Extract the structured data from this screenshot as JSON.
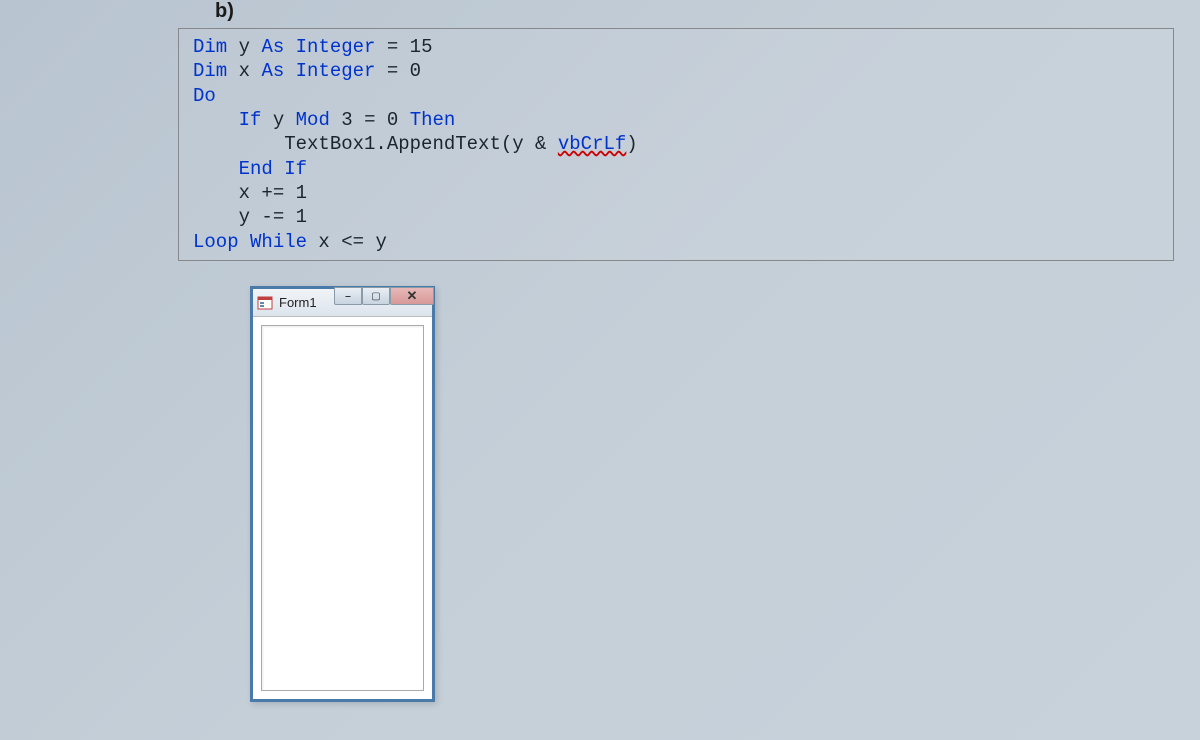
{
  "question_label": "b)",
  "code": {
    "l1_kw1": "Dim",
    "l1_txt": " y ",
    "l1_kw2": "As Integer",
    "l1_rest": " = 15",
    "l2_kw1": "Dim",
    "l2_txt": " x ",
    "l2_kw2": "As Integer",
    "l2_rest": " = 0",
    "l3_kw": "Do",
    "l4_kw1": "If",
    "l4_txt1": " y ",
    "l4_kw2": "Mod",
    "l4_txt2": " 3 = 0 ",
    "l4_kw3": "Then",
    "l5_txt": "TextBox1.AppendText(y & ",
    "l5_vb": "vbCrLf",
    "l5_end": ")",
    "l6_kw": "End If",
    "l7": "x += 1",
    "l8": "y -= 1",
    "l9_kw": "Loop While",
    "l9_txt": " x <= y"
  },
  "window": {
    "title": "Form1",
    "minimize": "⎯",
    "maximize": "▢",
    "close": "✕"
  }
}
